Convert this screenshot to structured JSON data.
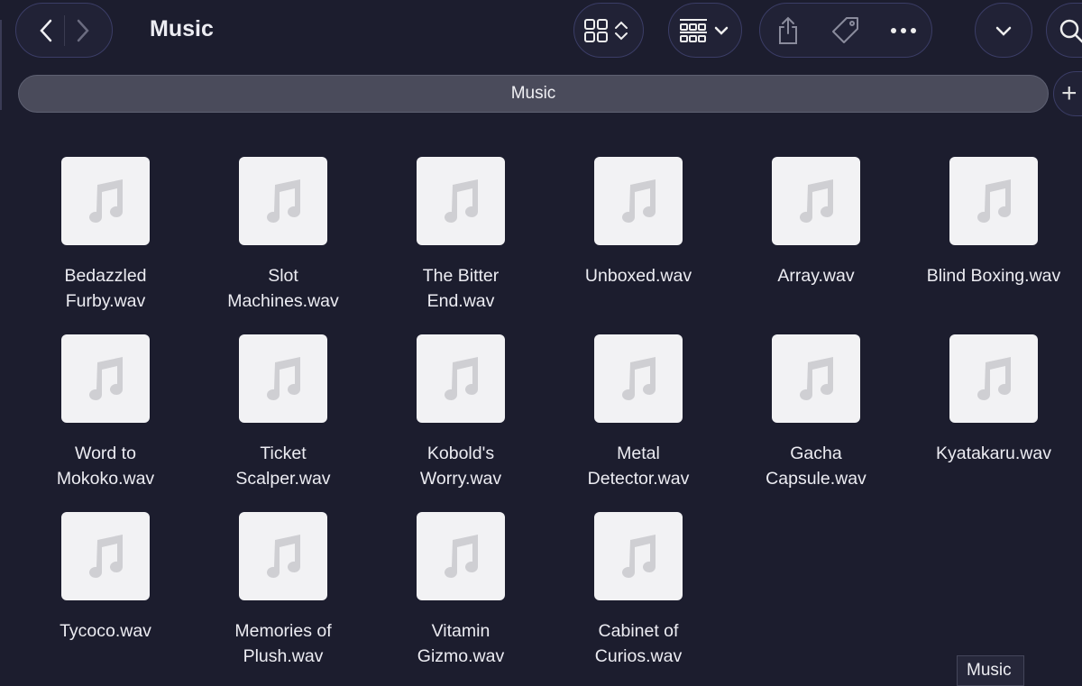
{
  "window": {
    "title": "Music"
  },
  "toolbar": {
    "back_icon": "chevron-left-icon",
    "forward_icon": "chevron-right-icon",
    "view_icon": "grid-view-icon",
    "group_icon": "group-by-icon",
    "share_icon": "share-icon",
    "tag_icon": "tag-icon",
    "more_icon": "ellipsis-icon",
    "dropdown_icon": "chevron-down-icon",
    "search_icon": "search-icon"
  },
  "tabs": [
    {
      "label": "Music",
      "active": true
    }
  ],
  "new_tab_label": "+",
  "files": [
    {
      "line1": "Bedazzled",
      "line2": "Furby.wav"
    },
    {
      "line1": "Slot",
      "line2": "Machines.wav"
    },
    {
      "line1": "The Bitter",
      "line2": "End.wav"
    },
    {
      "line1": "Unboxed.wav",
      "line2": ""
    },
    {
      "line1": "Array.wav",
      "line2": ""
    },
    {
      "line1": "Blind Boxing.wav",
      "line2": ""
    },
    {
      "line1": "Word to",
      "line2": "Mokoko.wav"
    },
    {
      "line1": "Ticket",
      "line2": "Scalper.wav"
    },
    {
      "line1": "Kobold's",
      "line2": "Worry.wav"
    },
    {
      "line1": "Metal",
      "line2": "Detector.wav"
    },
    {
      "line1": "Gacha",
      "line2": "Capsule.wav"
    },
    {
      "line1": "Kyatakaru.wav",
      "line2": ""
    },
    {
      "line1": "Tycoco.wav",
      "line2": ""
    },
    {
      "line1": "Memories of",
      "line2": "Plush.wav"
    },
    {
      "line1": "Vitamin",
      "line2": "Gizmo.wav"
    },
    {
      "line1": "Cabinet of",
      "line2": "Curios.wav"
    }
  ],
  "file_icon": "music-note-icon",
  "tooltip": "Music",
  "colors": {
    "background": "#1c1d2e",
    "tabbar": "#4a4b5b",
    "pill_border": "#3b3d66"
  }
}
